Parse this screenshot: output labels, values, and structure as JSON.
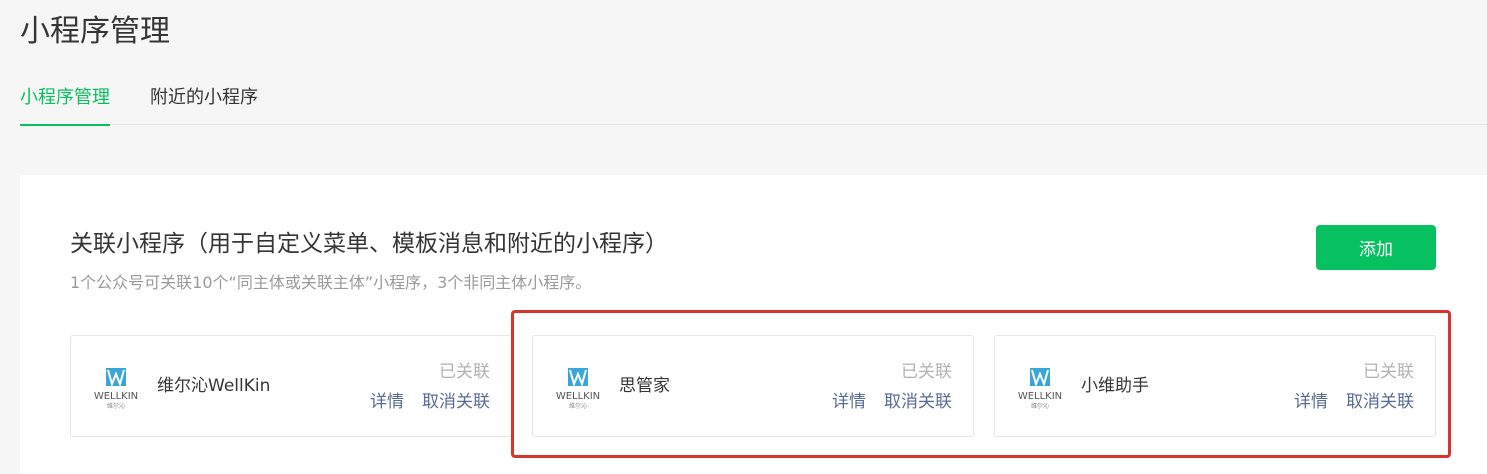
{
  "page": {
    "title": "小程序管理"
  },
  "tabs": [
    {
      "label": "小程序管理",
      "active": true
    },
    {
      "label": "附近的小程序",
      "active": false
    }
  ],
  "section": {
    "title": "关联小程序（用于自定义菜单、模板消息和附近的小程序）",
    "description": "1个公众号可关联10个“同主体或关联主体”小程序，3个非同主体小程序。",
    "add_label": "添加"
  },
  "cards": [
    {
      "name": "维尔沁WellKin",
      "status": "已关联",
      "detail_label": "详情",
      "unlink_label": "取消关联",
      "logo_icon": "wellkin-logo-icon"
    },
    {
      "name": "思管家",
      "status": "已关联",
      "detail_label": "详情",
      "unlink_label": "取消关联",
      "logo_icon": "wellkin-logo-icon"
    },
    {
      "name": "小维助手",
      "status": "已关联",
      "detail_label": "详情",
      "unlink_label": "取消关联",
      "logo_icon": "wellkin-logo-icon"
    }
  ],
  "logo": {
    "brand_text": "WELLKIN",
    "sub_text": "维尔沁"
  },
  "colors": {
    "accent": "#07c160",
    "link": "#576b95",
    "highlight": "#d9342b",
    "muted": "#b2b2b2"
  }
}
